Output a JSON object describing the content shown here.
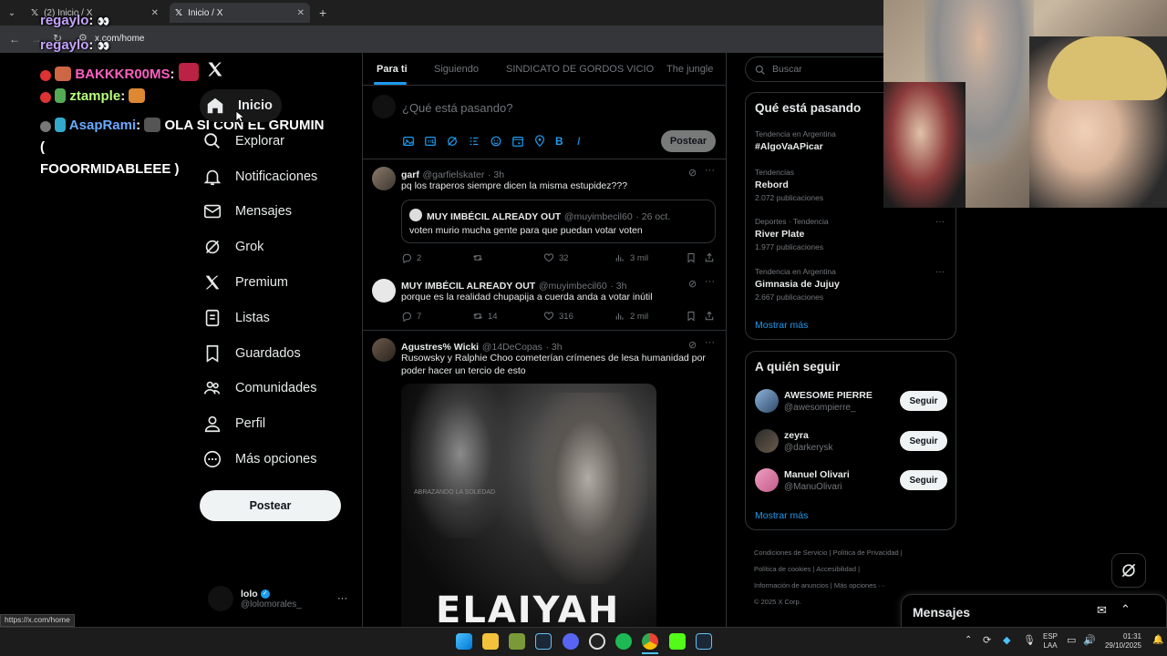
{
  "browser": {
    "tabs": [
      {
        "label": "(2) Inicio / X"
      },
      {
        "label": "Inicio / X"
      }
    ],
    "url": "x.com/home",
    "status_url": "https://x.com/home"
  },
  "chat": [
    {
      "user": "regaylo",
      "message": ""
    },
    {
      "user": "regaylo",
      "message": ""
    },
    {
      "user": "BAKKKR00MS",
      "message": ""
    },
    {
      "user": "ztample",
      "message": ""
    },
    {
      "user": "AsapRami",
      "message": "OLA SI CON EL GRUMIN (",
      "message2": "FOOORMIDABLEEE )"
    }
  ],
  "nav": {
    "items": [
      {
        "label": "Inicio",
        "icon": "home-icon"
      },
      {
        "label": "Explorar",
        "icon": "search-icon"
      },
      {
        "label": "Notificaciones",
        "icon": "bell-icon"
      },
      {
        "label": "Mensajes",
        "icon": "envelope-icon"
      },
      {
        "label": "Grok",
        "icon": "grok-icon"
      },
      {
        "label": "Premium",
        "icon": "x-logo-icon"
      },
      {
        "label": "Listas",
        "icon": "list-icon"
      },
      {
        "label": "Guardados",
        "icon": "bookmark-icon"
      },
      {
        "label": "Comunidades",
        "icon": "people-icon"
      },
      {
        "label": "Perfil",
        "icon": "person-icon"
      },
      {
        "label": "Más opciones",
        "icon": "more-circle-icon"
      }
    ],
    "post_label": "Postear",
    "profile": {
      "name": "lolo",
      "handle": "@lolomorales_"
    }
  },
  "feed": {
    "tabs": [
      "Para ti",
      "Siguiendo",
      "SINDICATO DE GORDOS VICIO",
      "The jungle"
    ],
    "compose_placeholder": "¿Qué está pasando?",
    "compose_post_label": "Postear",
    "tweets": [
      {
        "name": "garf",
        "handle": "@garfielskater",
        "time": "· 3h",
        "text": "pq los traperos siempre dicen la misma estupidez???",
        "quote": {
          "name": "MUY IMBÉCIL ALREADY OUT",
          "handle": "@muyimbecil60",
          "time": "· 26 oct.",
          "text": "voten murio mucha gente para que puedan votar voten"
        },
        "replies": "2",
        "retweets": "",
        "likes": "32",
        "views": "3 mil"
      },
      {
        "name": "MUY IMBÉCIL ALREADY OUT",
        "handle": "@muyimbecil60",
        "time": "· 3h",
        "text": "porque es la realidad chupapija a cuerda anda a votar inútil",
        "replies": "7",
        "retweets": "14",
        "likes": "316",
        "views": "2 mil"
      },
      {
        "name": "Agustres% Wicki",
        "handle": "@14DeCopas",
        "time": "· 3h",
        "text": "Rusowsky y Ralphie Choo cometerían crímenes de lesa humanidad por poder hacer un tercio de esto",
        "image_caption": "ABRAZANDO LA SOLEDAD",
        "image_title": "ELAIYAH"
      }
    ]
  },
  "sidebar": {
    "search_placeholder": "Buscar",
    "trends_title": "Qué está pasando",
    "trends": [
      {
        "meta": "Tendencia en Argentina",
        "name": "#AlgoVaAPicar",
        "count": ""
      },
      {
        "meta": "Tendencias",
        "name": "Rebord",
        "count": "2.072 publicaciones"
      },
      {
        "meta": "Deportes · Tendencia",
        "name": "River Plate",
        "count": "1.977 publicaciones"
      },
      {
        "meta": "Tendencia en Argentina",
        "name": "Gimnasia de Jujuy",
        "count": "2.667 publicaciones"
      }
    ],
    "show_more": "Mostrar más",
    "follow_title": "A quién seguir",
    "follow": [
      {
        "name": "AWESOME PIERRE",
        "handle": "@awesompierre_",
        "button": "Seguir"
      },
      {
        "name": "zeyra",
        "handle": "@darkerysk",
        "button": "Seguir"
      },
      {
        "name": "Manuel Olivari",
        "handle": "@ManuOlivari",
        "button": "Seguir"
      }
    ],
    "follow_show_more": "Mostrar más",
    "footer": [
      "Condiciones de Servicio",
      "Política de Privacidad",
      "Política de cookies",
      "Accesibilidad",
      "Información de anuncios",
      "Más opciones ···",
      "© 2025 X Corp."
    ]
  },
  "messages_bar": {
    "title": "Mensajes"
  },
  "taskbar": {
    "lang": "ESP",
    "lang2": "LAA",
    "time": "01:31",
    "date": "29/10/2025"
  },
  "colors": {
    "accent": "#1d9bf0",
    "background": "#000000",
    "border": "#2f3336",
    "muted": "#71767b"
  }
}
